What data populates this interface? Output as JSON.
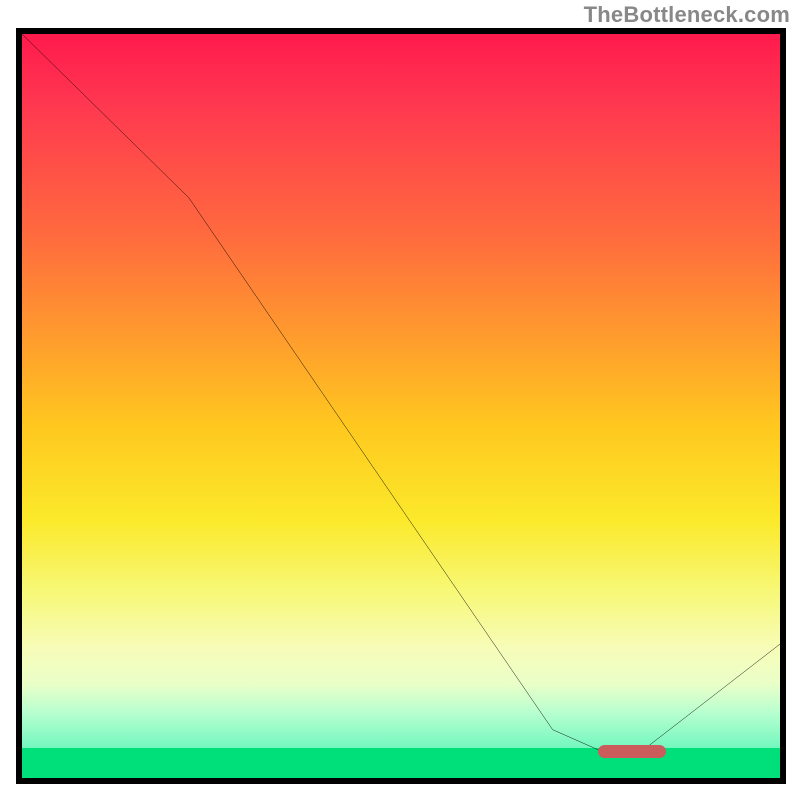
{
  "watermark": "TheBottleneck.com",
  "chart_data": {
    "type": "line",
    "title": "",
    "xlabel": "",
    "ylabel": "",
    "xlim": [
      0,
      100
    ],
    "ylim": [
      0,
      100
    ],
    "series": [
      {
        "name": "curve",
        "x": [
          0,
          22,
          70,
          76,
          82,
          100
        ],
        "y": [
          100,
          78,
          6.5,
          3.8,
          3.8,
          18
        ]
      }
    ],
    "marker": {
      "x_start": 76,
      "x_end": 85,
      "y": 3.5,
      "color": "#cc5c5c"
    },
    "gradient": {
      "stops": [
        {
          "pos": 0,
          "color": "#ff1a4d"
        },
        {
          "pos": 50,
          "color": "#ffcc22"
        },
        {
          "pos": 80,
          "color": "#f7f876"
        },
        {
          "pos": 96,
          "color": "#73f7bf"
        },
        {
          "pos": 100,
          "color": "#00e07a"
        }
      ]
    }
  }
}
